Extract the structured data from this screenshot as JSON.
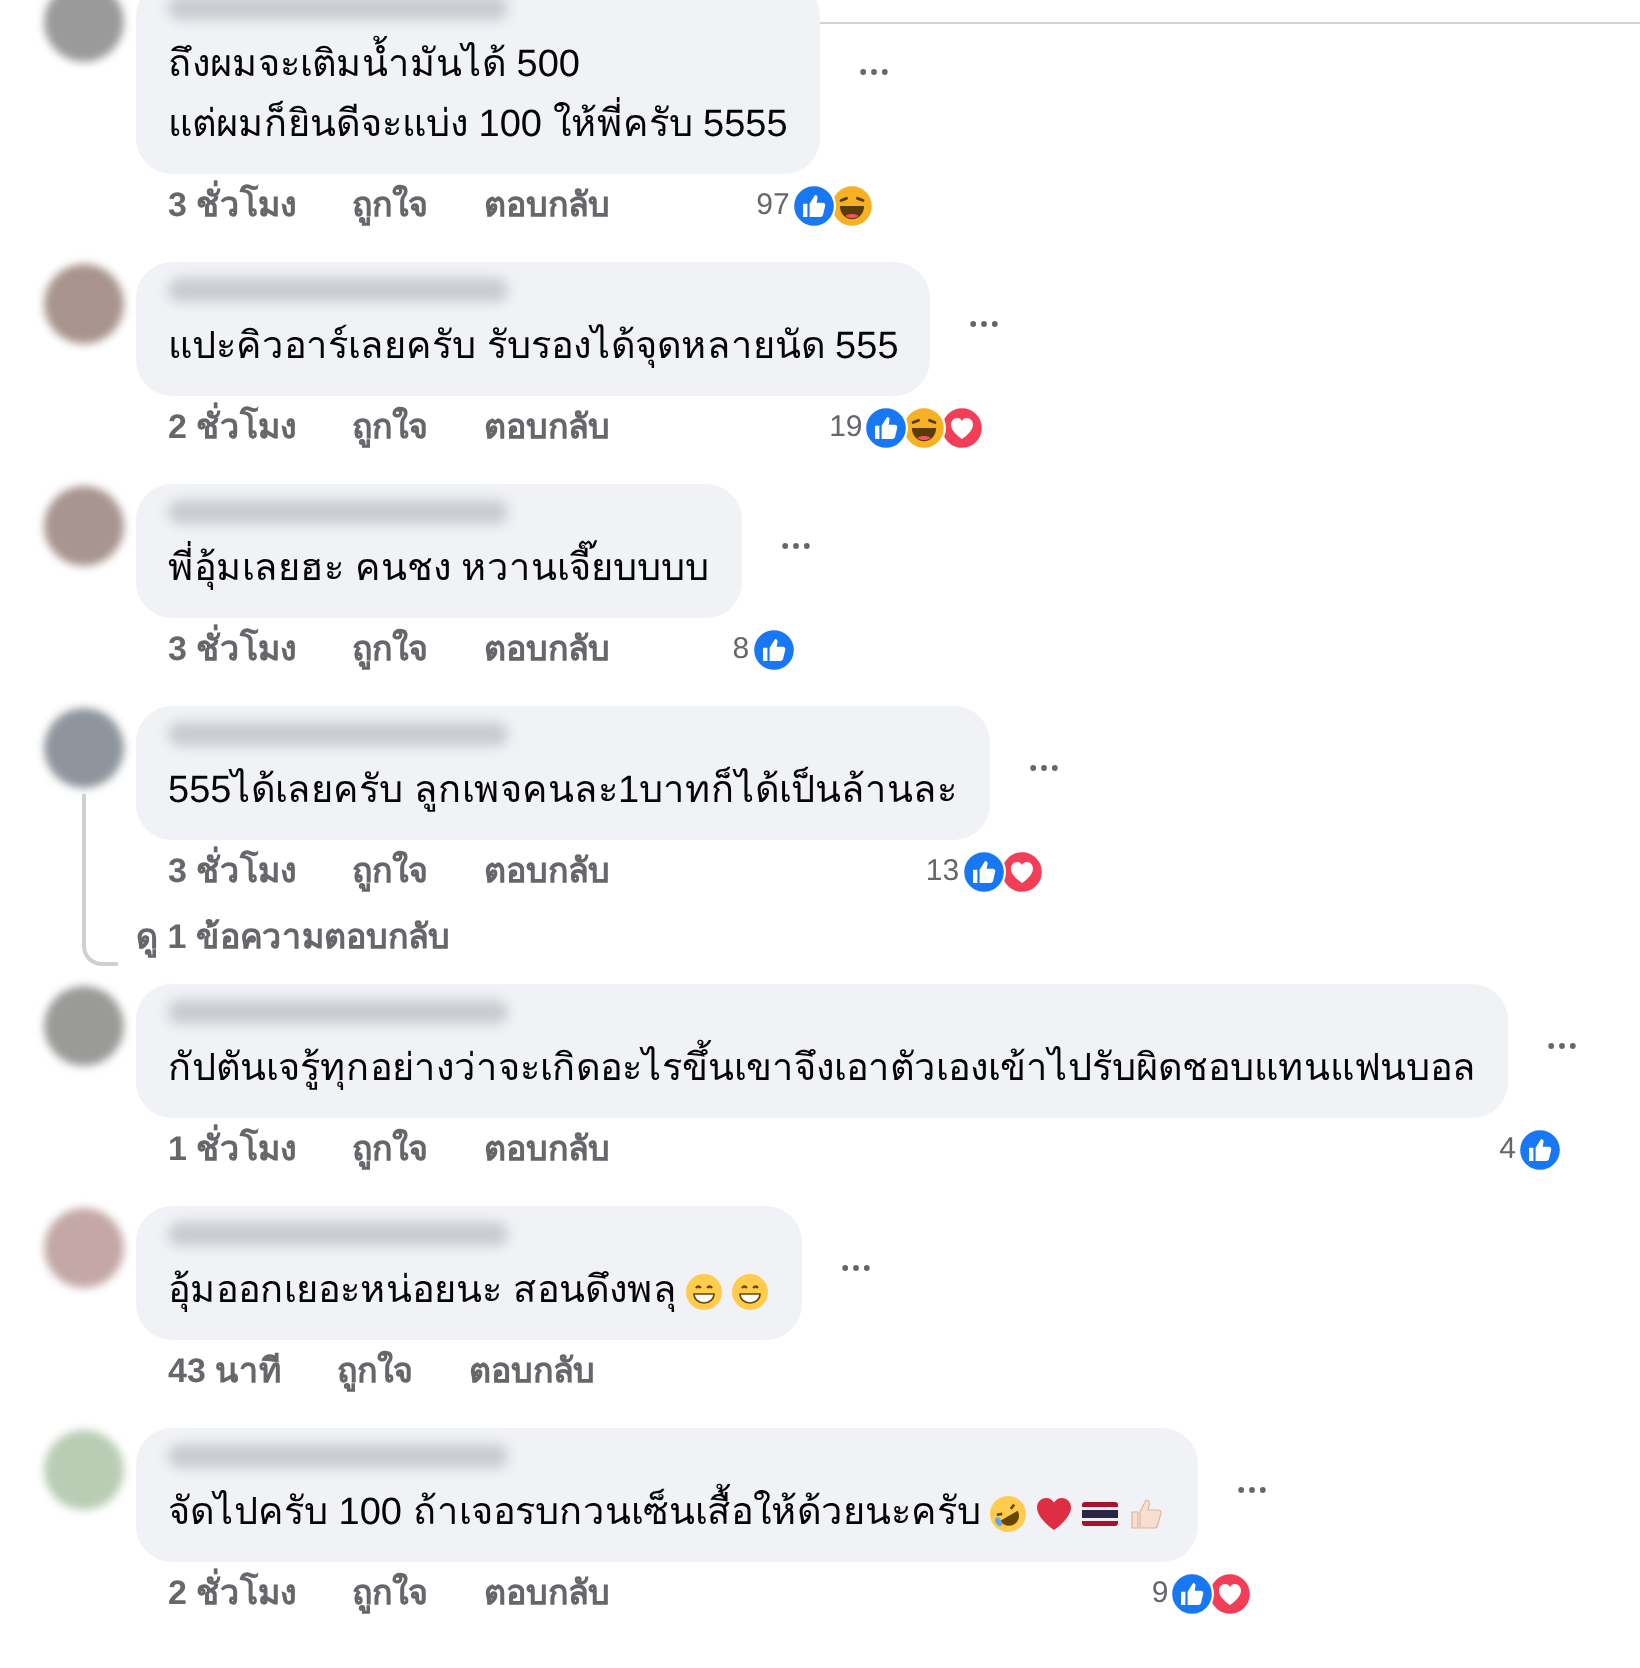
{
  "comments": [
    {
      "lines": [
        "ถึงผมจะเติมน้ำมันได้ 500",
        "แต่ผมก็ยินดีจะแบ่ง 100 ให้พี่ครับ 5555"
      ],
      "time": "3 ชั่วโมง",
      "like": "ถูกใจ",
      "reply": "ตอบกลับ",
      "count": "97",
      "reactions": [
        {
          "kind": "like"
        },
        {
          "kind": "haha"
        }
      ]
    },
    {
      "lines": [
        "แปะคิวอาร์เลยครับ รับรองได้จุดหลายนัด 555"
      ],
      "time": "2 ชั่วโมง",
      "like": "ถูกใจ",
      "reply": "ตอบกลับ",
      "count": "19",
      "reactions": [
        {
          "kind": "like"
        },
        {
          "kind": "haha"
        },
        {
          "kind": "love"
        }
      ]
    },
    {
      "lines": [
        "พี่อุ้มเลยฮะ คนชง หวานเจี๊ยบบบบ"
      ],
      "time": "3 ชั่วโมง",
      "like": "ถูกใจ",
      "reply": "ตอบกลับ",
      "count": "8",
      "reactions": [
        {
          "kind": "like"
        }
      ]
    },
    {
      "lines": [
        "555ได้เลยครับ ลูกเพจคนละ1บาทก็ได้เป็นล้านละ"
      ],
      "time": "3 ชั่วโมง",
      "like": "ถูกใจ",
      "reply": "ตอบกลับ",
      "count": "13",
      "reactions": [
        {
          "kind": "like"
        },
        {
          "kind": "love"
        }
      ],
      "replies_link": "ดู 1 ข้อความตอบกลับ"
    },
    {
      "lines": [
        "กัปตันเจรู้ทุกอย่างว่าจะเกิดอะไรขึ้นเขาจึงเอาตัวเองเข้าไปรับผิดชอบแทนแฟนบอล"
      ],
      "time": "1 ชั่วโมง",
      "like": "ถูกใจ",
      "reply": "ตอบกลับ",
      "count": "4",
      "reactions": [
        {
          "kind": "like"
        }
      ]
    },
    {
      "lines": [
        "อุ้มออกเยอะหน่อยนะ สอนดึงพลุ"
      ],
      "emojis": [
        {
          "kind": "grin"
        },
        {
          "kind": "grin"
        }
      ],
      "time": "43 นาที",
      "like": "ถูกใจ",
      "reply": "ตอบกลับ"
    },
    {
      "lines": [
        "จัดไปครับ 100 ถ้าเจอรบกวนเซ็นเสื้อให้ด้วยนะครับ"
      ],
      "emojis": [
        {
          "kind": "rofl"
        },
        {
          "kind": "heart"
        },
        {
          "kind": "flag"
        },
        {
          "kind": "thumb"
        }
      ],
      "time": "2 ชั่วโมง",
      "like": "ถูกใจ",
      "reply": "ตอบกลับ",
      "count": "9",
      "reactions": [
        {
          "kind": "like"
        },
        {
          "kind": "love"
        }
      ]
    }
  ]
}
